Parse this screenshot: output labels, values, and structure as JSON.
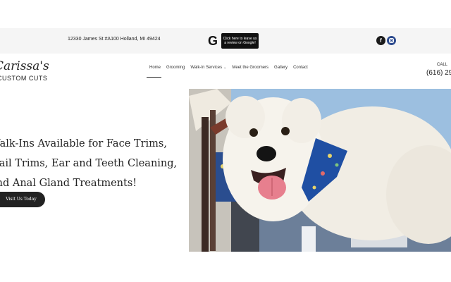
{
  "topbar": {
    "address": "12330 James St #A100 Holland, MI 49424",
    "google_letter": "G",
    "review_line1": "Click here to leave us",
    "review_line2": "a review on Google!",
    "facebook_icon": "facebook-icon",
    "instagram_icon": "instagram-icon"
  },
  "logo": {
    "script": "Carissa's",
    "sub": "CUSTOM CUTS"
  },
  "nav": {
    "items": [
      {
        "label": "Home"
      },
      {
        "label": "Grooming"
      },
      {
        "label": "Walk-In Services"
      },
      {
        "label": "Meet the Groomers"
      },
      {
        "label": "Gallery"
      },
      {
        "label": "Contact"
      }
    ]
  },
  "contact": {
    "call_label": "CALL",
    "phone": "(616) 29"
  },
  "hero": {
    "line1": "Walk-Ins Available for Face Trims,",
    "line2": "Nail Trims, Ear and Teeth Cleaning,",
    "line3": "and Anal Gland Treatments!",
    "cta_label": "Visit Us Today"
  },
  "colors": {
    "accent": "#222222",
    "photo_sky": "#8fb4d9"
  }
}
